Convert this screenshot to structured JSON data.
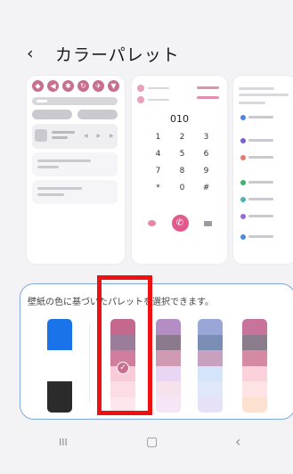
{
  "header": {
    "back_glyph": "‹",
    "title": "カラーパレット"
  },
  "dialer": {
    "number": "010",
    "keys": [
      "1",
      "2",
      "3",
      "4",
      "5",
      "6",
      "7",
      "8",
      "9",
      "*",
      "0",
      "#"
    ]
  },
  "quick_panel_icons": [
    "wifi-icon",
    "sound-icon",
    "bluetooth-icon",
    "rotate-icon",
    "airplane-icon",
    "flashlight-icon"
  ],
  "settings_dot_colors": [
    "#4a86e8",
    "#7c5cd6",
    "#e8766a",
    "#3bb36a",
    "#4bb5b0",
    "#9a6ad6",
    "#4a8be0"
  ],
  "palette": {
    "description": "壁紙の色に基づいたパレットを選択できます。",
    "selected_index": 1,
    "swatches": [
      {
        "name": "swatch-basic",
        "colors": [
          "#1a73e8",
          "#ffffff",
          "#2b2b2b"
        ]
      },
      {
        "name": "swatch-pink",
        "colors": [
          "#c5688d",
          "#9a7d98",
          "#cf7f9d",
          "#f8cbd7",
          "#fcdde4",
          "#fde6ec"
        ]
      },
      {
        "name": "swatch-purple",
        "colors": [
          "#b28ec4",
          "#8b7a8c",
          "#cf9ab2",
          "#e8d6f4",
          "#f6e2ec",
          "#f5e5f5"
        ]
      },
      {
        "name": "swatch-blue",
        "colors": [
          "#9aa6d8",
          "#7a8db4",
          "#c7a1bf",
          "#d4e4fa",
          "#dfe8fa",
          "#e7e1f7"
        ]
      },
      {
        "name": "swatch-rose",
        "colors": [
          "#c8749a",
          "#8b7c8c",
          "#d48aa3",
          "#fbd1dc",
          "#fde3e4",
          "#fde1d0"
        ]
      }
    ]
  },
  "navbar": {
    "recent": "III",
    "home": "▢",
    "back": "‹"
  }
}
